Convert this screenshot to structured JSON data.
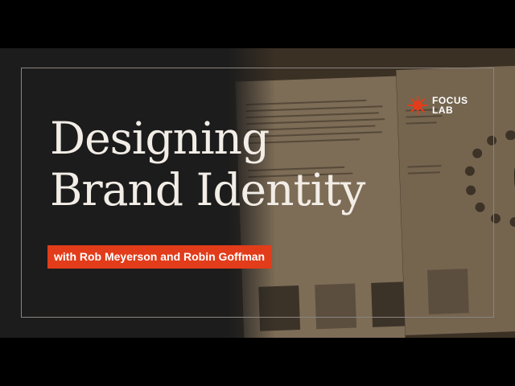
{
  "title": {
    "line1": "Designing",
    "line2": "Brand Identity"
  },
  "subtitle": "with Rob Meyerson and Robin Goffman",
  "logo": {
    "line1": "FOCUS",
    "line2": "LAB",
    "icon": "sun-burst-icon",
    "color": "#e23c1a"
  },
  "colors": {
    "background": "#1c1c1c",
    "accent": "#e23c1a",
    "text": "#f2ede6"
  }
}
